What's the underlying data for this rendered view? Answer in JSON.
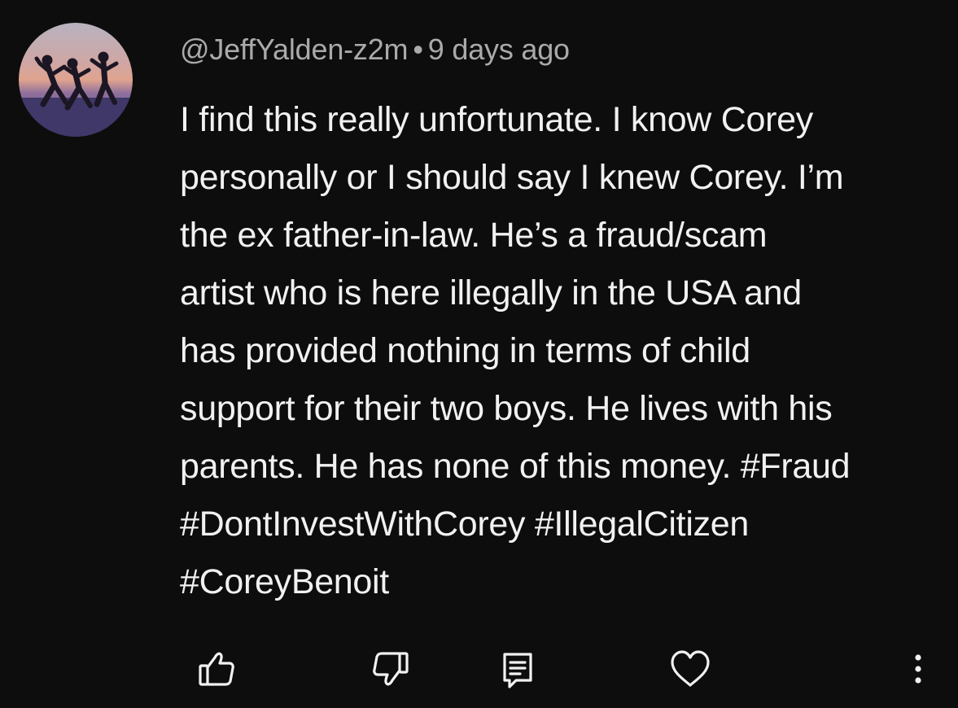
{
  "comment": {
    "author": "@JeffYalden-z2m",
    "separator": "•",
    "time_ago": "9 days ago",
    "lines": [
      "I find this really unfortunate. I know Corey",
      "personally or I should say I knew Corey. I’m",
      "the ex father-in-law. He’s a fraud/scam",
      "artist who is here illegally in the USA and",
      "has provided nothing in terms of child",
      "support for their two boys. He lives with his",
      "parents. He has none of this money. #Fraud",
      "#DontInvestWithCorey #IllegalCitizen",
      "#CoreyBenoit"
    ]
  },
  "actions": {
    "like_icon": "thumbs-up-icon",
    "dislike_icon": "thumbs-down-icon",
    "reply_icon": "reply-comment-icon",
    "heart_icon": "heart-icon",
    "more_icon": "more-vertical-icon"
  },
  "colors": {
    "background": "#0d0d0d",
    "text": "#f1f1f1",
    "meta_text": "#aaaaaa"
  }
}
